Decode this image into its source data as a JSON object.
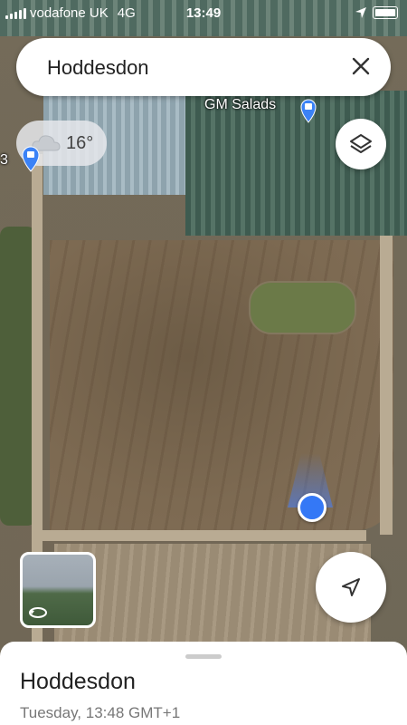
{
  "status_bar": {
    "carrier": "vodafone UK",
    "network": "4G",
    "time": "13:49"
  },
  "search": {
    "query": "Hoddesdon",
    "close_icon": "close-icon"
  },
  "weather": {
    "temperature": "16°",
    "icon": "cloud-icon"
  },
  "map": {
    "poi_label": "GM Salads",
    "edge_label": "3",
    "layers_icon": "layers-icon",
    "location_marker": "current-location-dot",
    "nav_icon": "navigation-arrow-icon",
    "street_view_icon": "rotate-arrow-icon"
  },
  "bottom_sheet": {
    "title": "Hoddesdon",
    "subtitle": "Tuesday, 13:48 GMT+1"
  },
  "colors": {
    "location_blue": "#3478f6",
    "pin_blue": "#3b82f6"
  }
}
